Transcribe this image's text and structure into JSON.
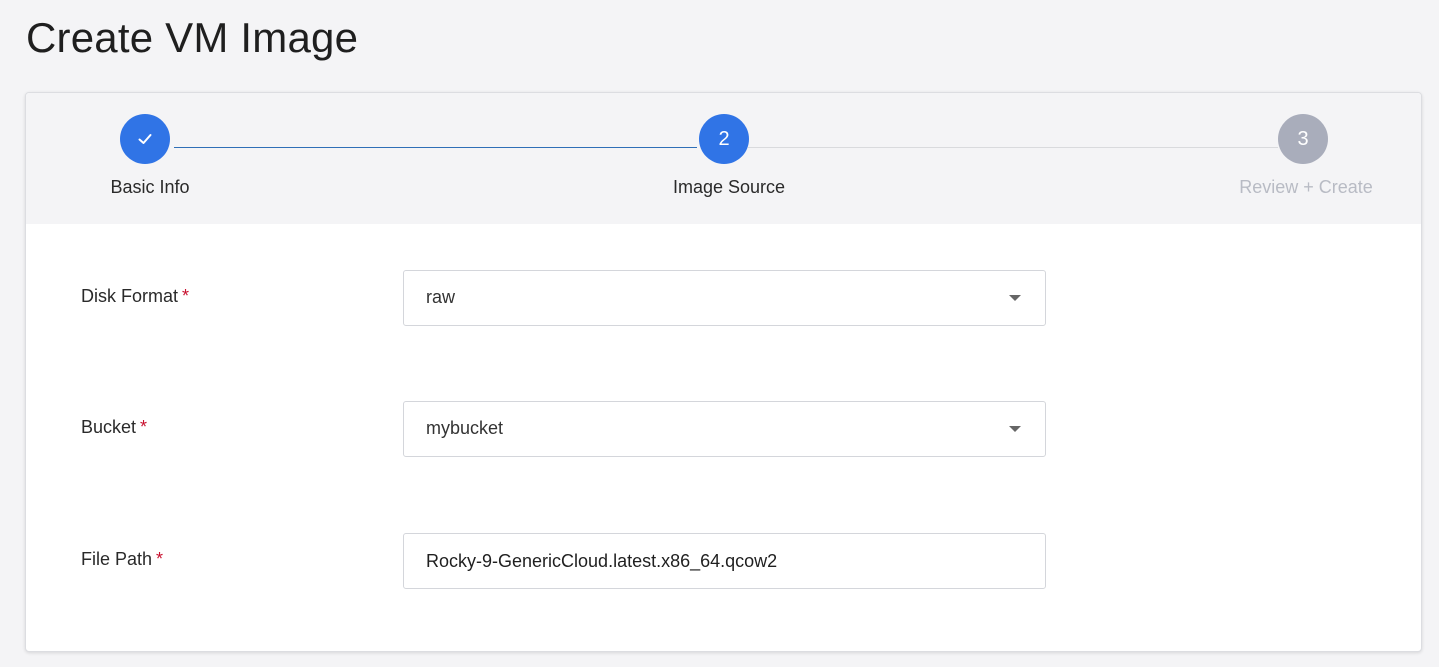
{
  "page": {
    "title": "Create VM Image"
  },
  "stepper": {
    "steps": [
      {
        "number": "1",
        "label": "Basic Info",
        "state": "complete",
        "icon": "check-icon"
      },
      {
        "number": "2",
        "label": "Image Source",
        "state": "active"
      },
      {
        "number": "3",
        "label": "Review + Create",
        "state": "pending"
      }
    ]
  },
  "form": {
    "disk_format": {
      "label": "Disk Format",
      "required_mark": "*",
      "value": "raw"
    },
    "bucket": {
      "label": "Bucket",
      "required_mark": "*",
      "value": "mybucket"
    },
    "file_path": {
      "label": "File Path",
      "required_mark": "*",
      "value": "Rocky-9-GenericCloud.latest.x86_64.qcow2"
    }
  },
  "colors": {
    "primary": "#3074e6",
    "pending": "#a9adbb",
    "required": "#c8102e",
    "background": "#f4f4f6"
  }
}
